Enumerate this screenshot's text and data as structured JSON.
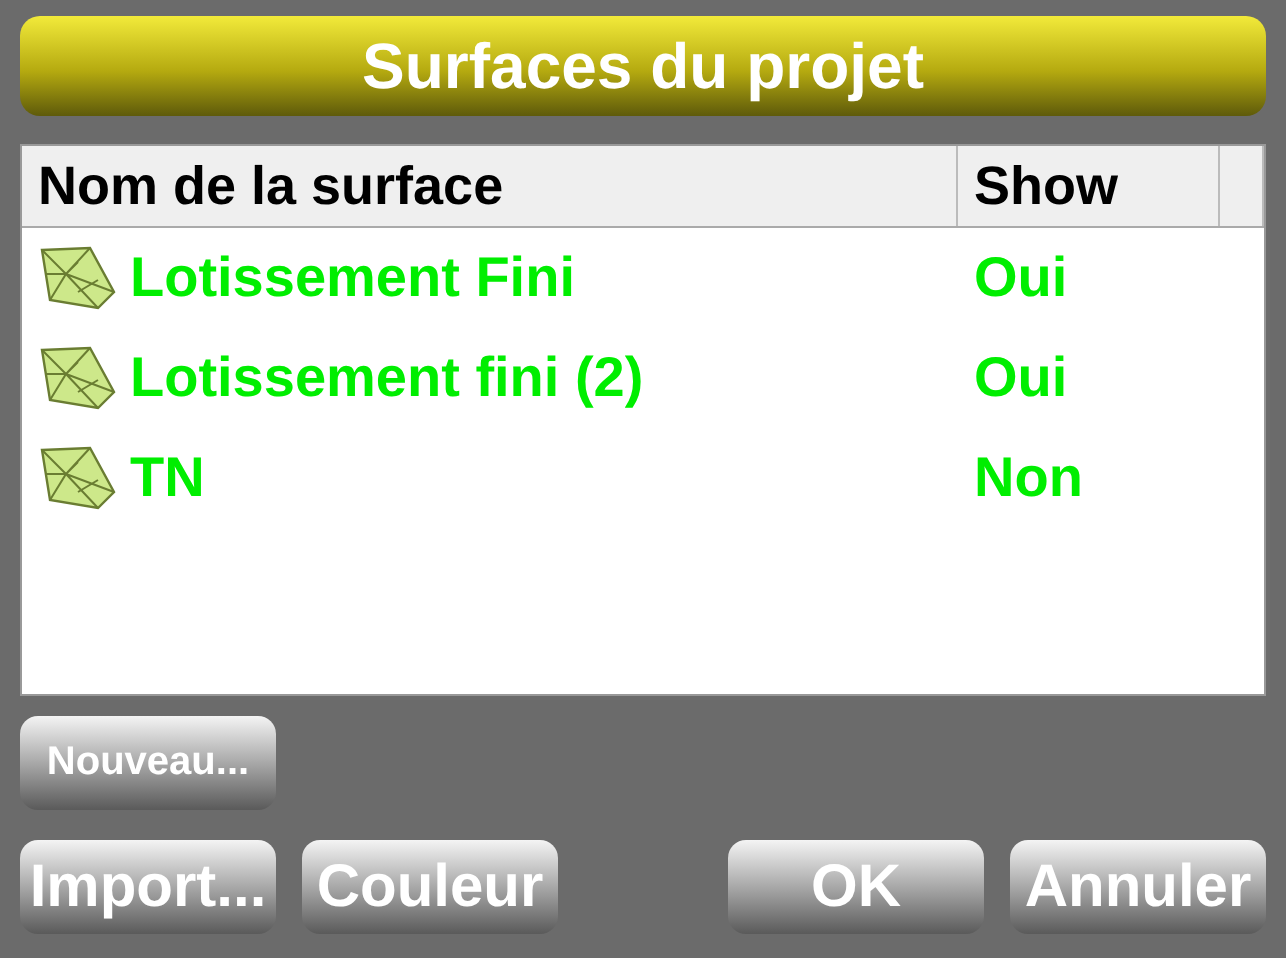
{
  "window": {
    "title": "Surfaces du projet"
  },
  "table": {
    "columns": [
      "Nom de la surface",
      "Show"
    ],
    "rows": [
      {
        "name": "Lotissement Fini",
        "show": "Oui"
      },
      {
        "name": "Lotissement fini (2)",
        "show": "Oui"
      },
      {
        "name": "TN",
        "show": "Non"
      }
    ]
  },
  "buttons": [
    {
      "label": "Nouveau...",
      "kind": "small"
    },
    {
      "label": "Import...",
      "kind": "left"
    },
    {
      "label": "Couleur",
      "kind": "left"
    },
    {
      "label": "OK",
      "kind": "right"
    },
    {
      "label": "Annuler",
      "kind": "right"
    }
  ]
}
